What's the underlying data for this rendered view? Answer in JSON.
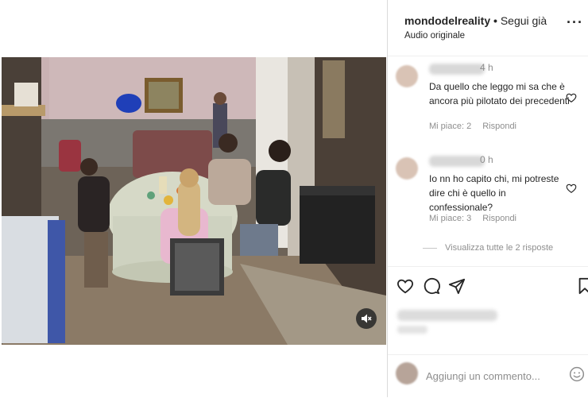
{
  "post": {
    "username": "mondodelreality",
    "separator": " • ",
    "follow_label": "Segui già",
    "audio_label": "Audio originale",
    "more_label": "···"
  },
  "comments": [
    {
      "time": "4 h",
      "text": "Da quello che leggo mi sa che è ancora più pilotato dei precedenti",
      "likes": "Mi piace: 2",
      "reply": "Rispondi"
    },
    {
      "time": "0 h",
      "text": "Io nn ho capito chi, mi potreste dire chi è quello in confessionale?",
      "likes": "Mi piace: 3",
      "reply": "Rispondi"
    }
  ],
  "view_replies": "Visualizza tutte le 2 risposte",
  "add_comment_placeholder": "Aggiungi un commento...",
  "icons": {
    "like": "heart-icon",
    "comment": "comment-icon",
    "share": "send-icon",
    "save": "bookmark-icon",
    "mute": "speaker-muted-icon",
    "emoji": "emoji-icon",
    "more": "more-icon"
  },
  "colors": {
    "text": "#262626",
    "secondary": "#8e8e8e",
    "divider": "#dbdbdb"
  }
}
